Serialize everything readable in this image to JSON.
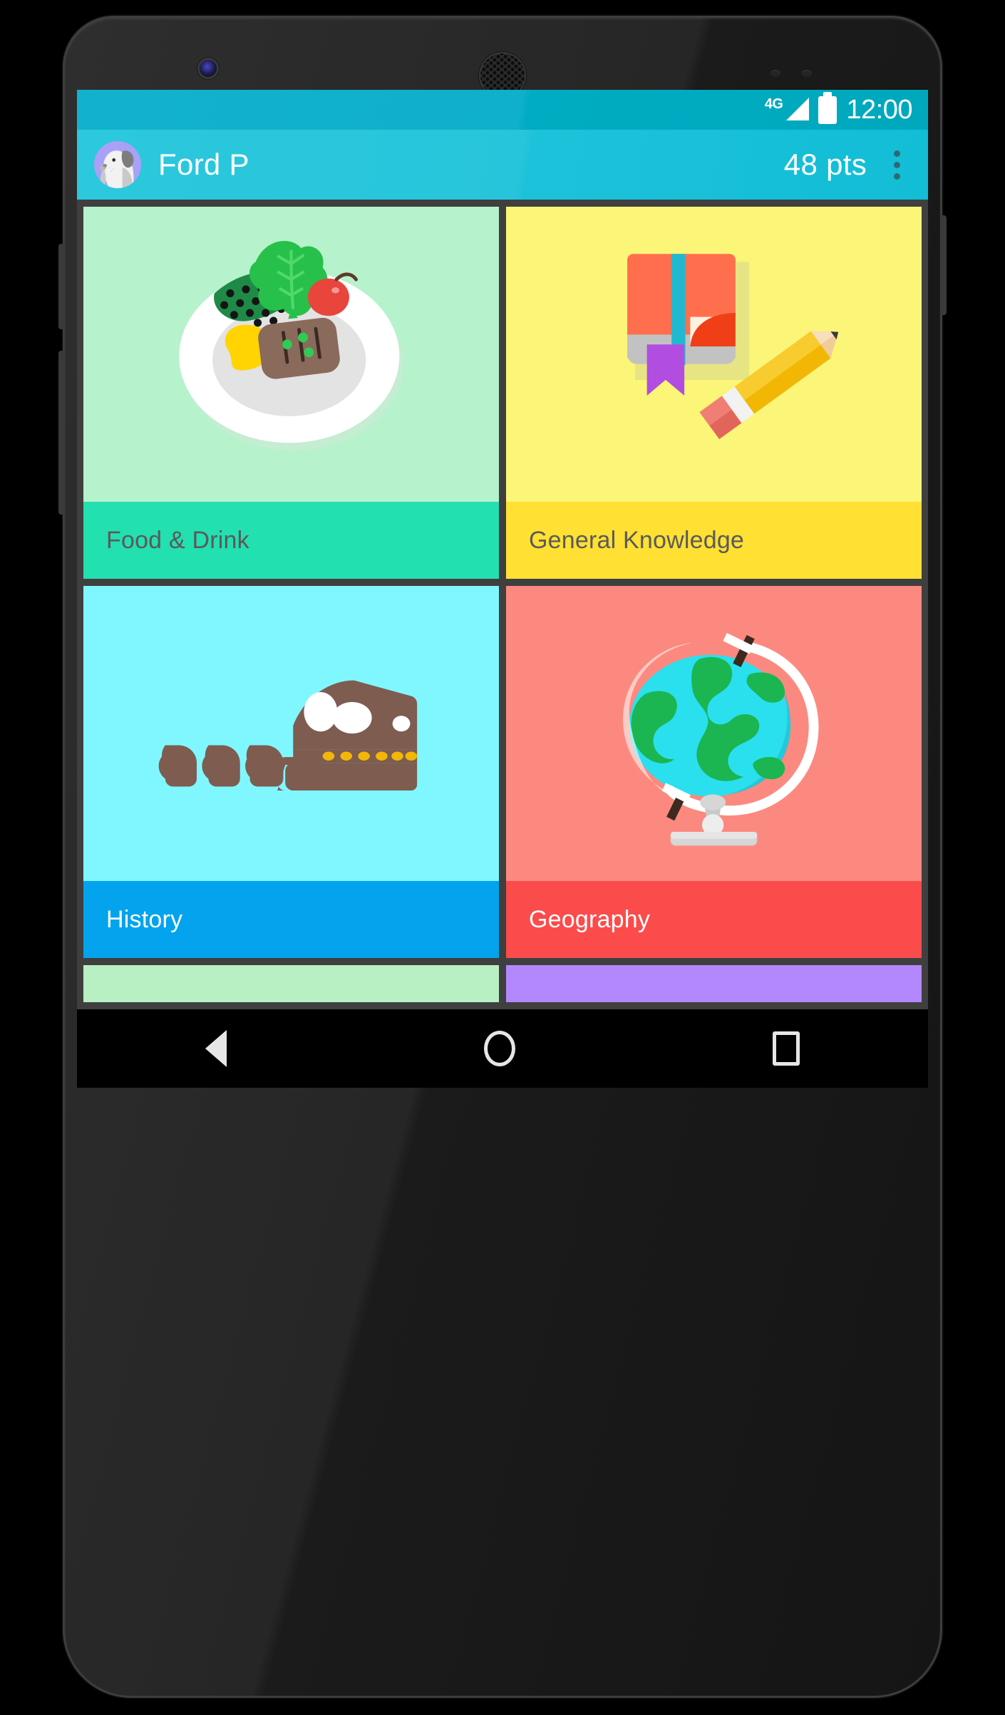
{
  "status_bar": {
    "network_label": "4G",
    "clock": "12:00",
    "icons": [
      "signal-triangle-icon",
      "battery-icon"
    ],
    "background_color": "#00ACC1"
  },
  "app_bar": {
    "avatar_name": "avatar",
    "username": "Ford P",
    "points": "48 pts",
    "overflow_menu_name": "overflow-menu-icon",
    "background_color": "#1CC2DA"
  },
  "grid": {
    "gap_color": "#3F3F3F",
    "tiles": [
      {
        "label": "Food & Drink",
        "icon": "plate-of-food-icon",
        "art_bg": "#B6F2CB",
        "label_bg": "#22E0B0",
        "label_color": "#5A5A5A"
      },
      {
        "label": "General Knowledge",
        "icon": "book-and-pencil-icon",
        "art_bg": "#FBF578",
        "label_bg": "#FFE033",
        "label_color": "#5A5A5A"
      },
      {
        "label": "History",
        "icon": "dinosaur-skull-icon",
        "art_bg": "#80F7FF",
        "label_bg": "#03A3ED",
        "label_color": "#FFFFFF"
      },
      {
        "label": "Geography",
        "icon": "globe-on-stand-icon",
        "art_bg": "#FC897F",
        "label_bg": "#FB4B4B",
        "label_color": "#FFFFFF"
      }
    ],
    "partial_tiles": [
      {
        "art_bg": "#B8F0C4"
      },
      {
        "art_bg": "#B388FF"
      }
    ]
  },
  "nav_bar": {
    "back_label": "back-button",
    "home_label": "home-button",
    "recents_label": "recents-button",
    "background_color": "#000000"
  },
  "device": {
    "front_camera": "front-camera",
    "earpiece": "earpiece-speaker",
    "sensors": "proximity-sensor"
  }
}
